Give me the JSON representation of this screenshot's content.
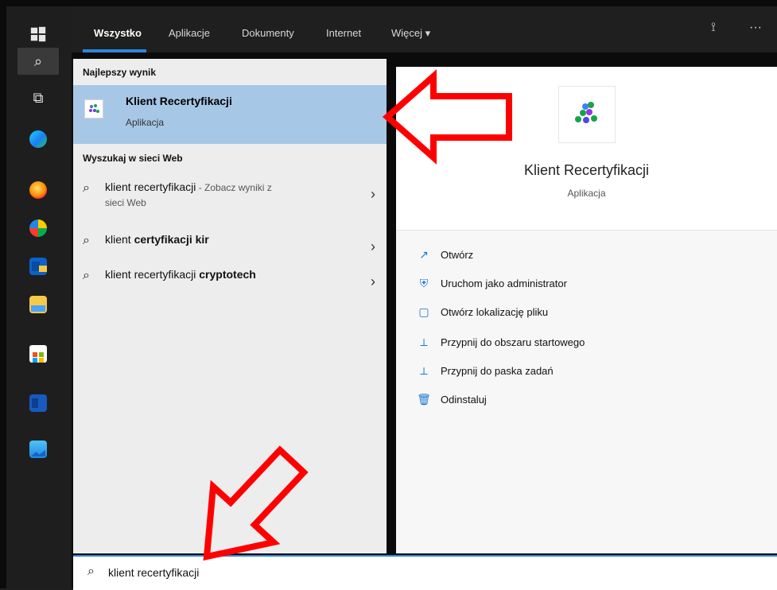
{
  "topbar": {
    "tabs": [
      {
        "label": "Wszystko"
      },
      {
        "label": "Aplikacje"
      },
      {
        "label": "Dokumenty"
      },
      {
        "label": "Internet"
      },
      {
        "label": "Więcej ▾"
      }
    ],
    "icons": {
      "feedback": "feedback-icon",
      "more": "more-icon"
    },
    "more_label": "···"
  },
  "results": {
    "best_title": "Najlepszy wynik",
    "best": {
      "title": "Klient Recertyfikacji",
      "subtitle": "Aplikacja"
    },
    "web_title": "Wyszukaj w sieci Web",
    "web_rows": [
      {
        "prefix": "klient recertyfikacji",
        "suffix_muted": " - Zobacz wyniki z",
        "line2_muted": "sieci Web"
      },
      {
        "prefix": "klient ",
        "bold": "certyfikacji kir"
      },
      {
        "prefix": "klient recertyfikacji ",
        "bold": "cryptotech"
      }
    ]
  },
  "details": {
    "app_title": "Klient Recertyfikacji",
    "app_subtitle": "Aplikacja",
    "actions": [
      {
        "label": "Otwórz",
        "icon": "open-icon"
      },
      {
        "label": "Uruchom jako administrator",
        "icon": "admin-shield-icon"
      },
      {
        "label": "Otwórz lokalizację pliku",
        "icon": "file-location-icon"
      },
      {
        "label": "Przypnij do obszaru startowego",
        "icon": "pin-icon"
      },
      {
        "label": "Przypnij do paska zadań",
        "icon": "pin-icon"
      },
      {
        "label": "Odinstaluj",
        "icon": "trash-icon"
      }
    ]
  },
  "search": {
    "query": "klient recertyfikacji"
  },
  "rail": {
    "items": [
      "windows-logo-icon",
      "search-icon",
      "task-view-icon",
      "edge-icon",
      "firefox-icon",
      "app-icon",
      "outlook-icon",
      "file-explorer-icon",
      "store-icon",
      "word-icon",
      "photos-icon"
    ]
  }
}
